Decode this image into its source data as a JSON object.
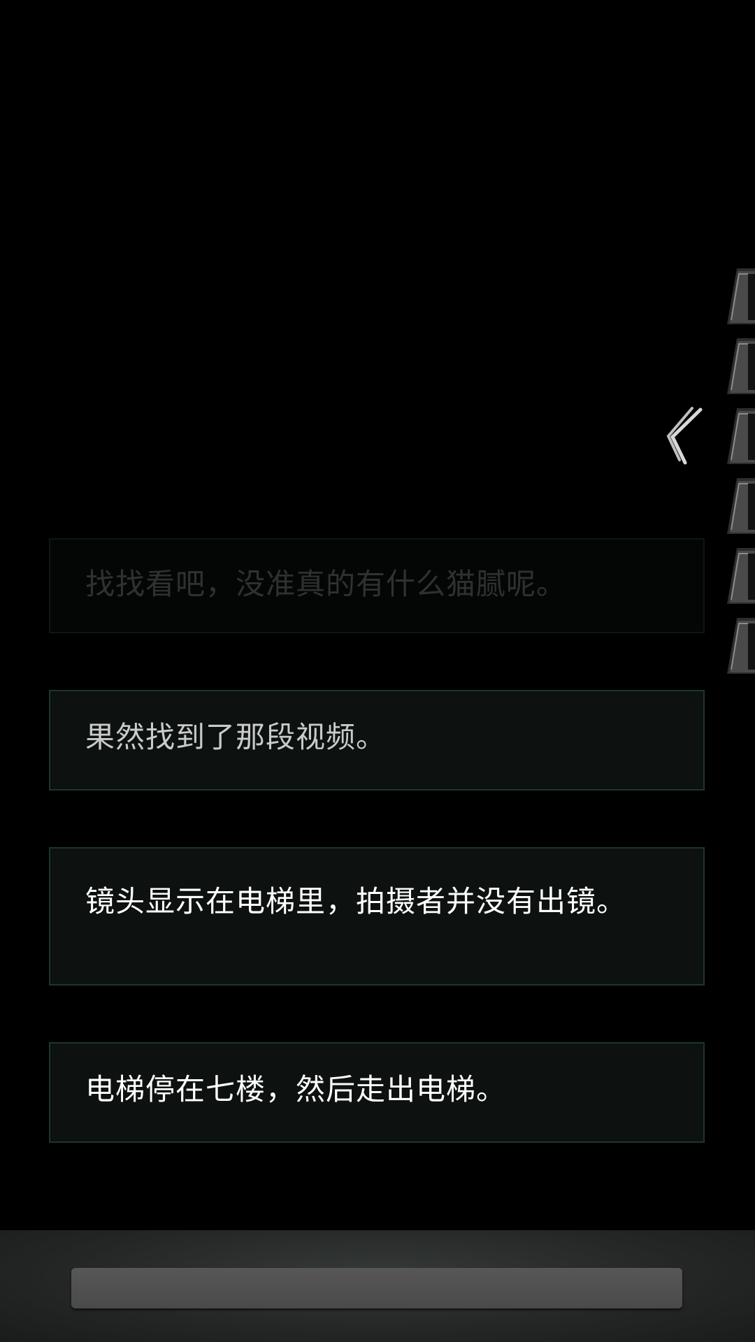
{
  "story": {
    "lines": [
      "找找看吧，没准真的有什么猫腻呢。",
      "果然找到了那段视频。",
      "镜头显示在电梯里，拍摄者并没有出镜。",
      "电梯停在七楼，然后走出电梯。"
    ]
  },
  "side_panel": {
    "tab_icon": "mountain-thumbnail-icon",
    "tab_count": 6,
    "toggle_icon": "double-chevron-left-icon"
  },
  "bottom_bar": {
    "input_value": ""
  },
  "colors": {
    "background": "#000000",
    "box_fill": "#0d1110",
    "box_border": "#1d3530",
    "text": "#ffffff"
  }
}
